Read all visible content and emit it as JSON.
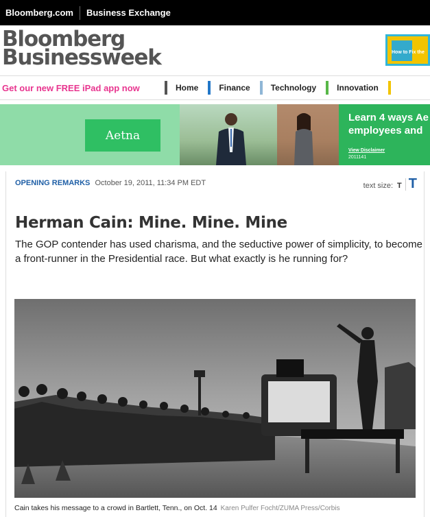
{
  "topbar": {
    "link1": "Bloomberg.com",
    "link2": "Business Exchange"
  },
  "masthead": {
    "line1": "Bloomberg",
    "line2": "Businessweek"
  },
  "cover": {
    "text": "How to Fix the"
  },
  "nav": {
    "promo": "Get our new FREE iPad app now",
    "items": [
      {
        "label": "Home",
        "color": "#555555"
      },
      {
        "label": "Finance",
        "color": "#2277c8"
      },
      {
        "label": "Technology",
        "color": "#8fb6d6"
      },
      {
        "label": "Innovation",
        "color": "#58b848"
      }
    ],
    "trailing_color": "#f2c400"
  },
  "ad": {
    "brand": "Aetna",
    "headline_line1": "Learn 4 ways Ae",
    "headline_line2": "employees and",
    "disclaimer": "View Disclaimer",
    "code": "2011141"
  },
  "article": {
    "kicker": "OPENING REMARKS",
    "dateline": "October 19, 2011, 11:34 PM EDT",
    "text_size_label": "text size:",
    "text_size_small": "T",
    "text_size_large": "T",
    "title": "Herman Cain: Mine. Mine. Mine",
    "dek": "The GOP contender has used charisma, and the seductive power of simplicity, to become a front-runner in the Presidential race. But what exactly is he running for?",
    "caption": "Cain takes his message to a crowd in Bartlett, Tenn., on Oct. 14",
    "credit": "Karen Pulfer Focht/ZUMA Press/Corbis"
  }
}
